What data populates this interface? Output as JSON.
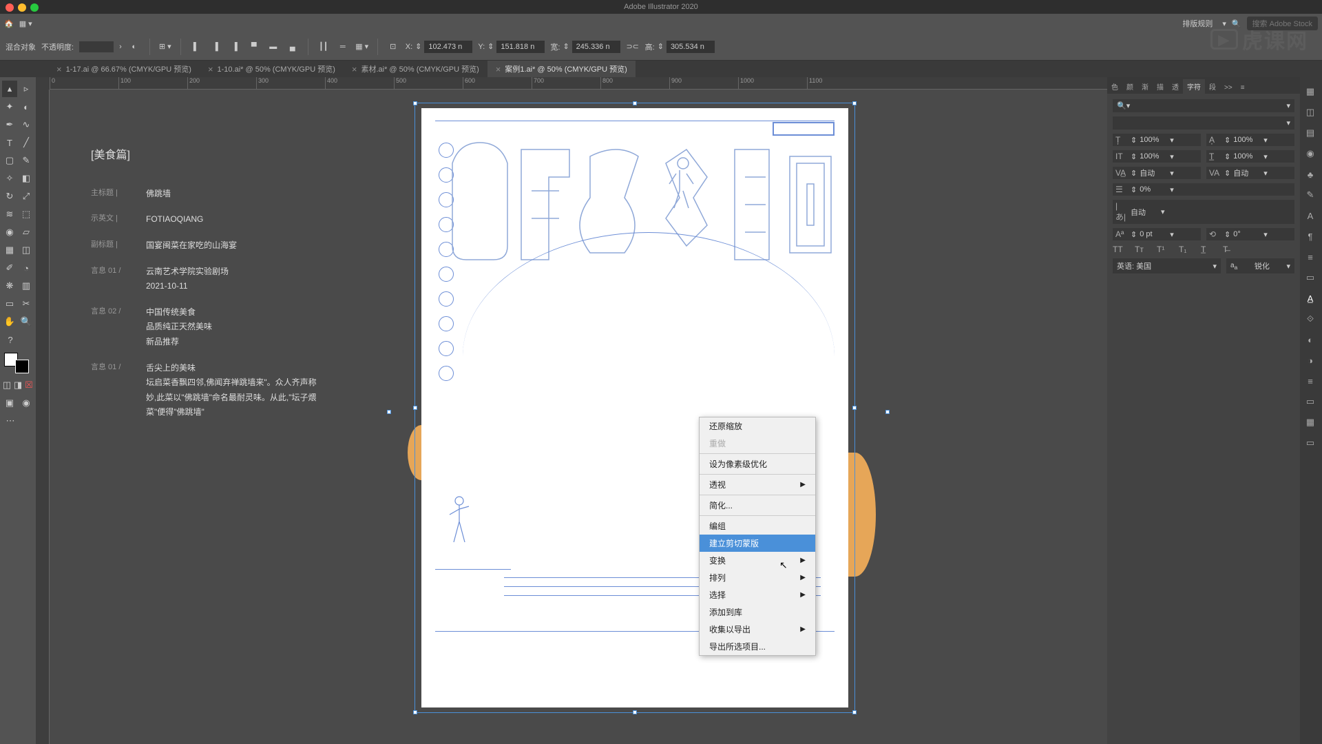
{
  "app_title": "Adobe Illustrator 2020",
  "menubar": {
    "layout_rules": "排版规则",
    "search_placeholder": "搜索 Adobe Stock"
  },
  "control_bar": {
    "object_label": "混合对象",
    "opacity_label": "不透明度:",
    "opacity_value": "",
    "x_label": "X:",
    "x_value": "102.473 n",
    "y_label": "Y:",
    "y_value": "151.818 n",
    "w_label": "宽:",
    "w_value": "245.336 n",
    "h_label": "高:",
    "h_value": "305.534 n"
  },
  "tabs": [
    {
      "label": "1-17.ai @ 66.67% (CMYK/GPU 预览)",
      "active": false
    },
    {
      "label": "1-10.ai* @ 50% (CMYK/GPU 预览)",
      "active": false
    },
    {
      "label": "素材.ai* @ 50% (CMYK/GPU 预览)",
      "active": false
    },
    {
      "label": "案例1.ai* @ 50% (CMYK/GPU 预览)",
      "active": true
    }
  ],
  "ruler_marks": [
    "0",
    "100",
    "200",
    "300",
    "400",
    "500",
    "600",
    "700",
    "800",
    "900",
    "1000",
    "1100"
  ],
  "notes": {
    "title": "[美食篇]",
    "rows": [
      {
        "label": "主标题 |",
        "value": "佛跳墙"
      },
      {
        "label": "示英文 |",
        "value": "FOTIAOQIANG"
      },
      {
        "label": "副标题 |",
        "value": "国宴闽菜在家吃的山海宴"
      },
      {
        "label": "言息 01 /",
        "value": "云南艺术学院实验剧场\n2021-10-11"
      },
      {
        "label": "言息 02 /",
        "value": "中国传统美食\n品质纯正天然美味\n新品推荐"
      },
      {
        "label": "言息 01 /",
        "value": "舌尖上的美味\n坛启菜香飘四邻,佛闻弃禅跳墙来\"。众人齐声称妙,此菜以\"佛跳墙\"命名最耐灵味。从此,\"坛子煨菜\"便得\"佛跳墙\""
      }
    ]
  },
  "context_menu": {
    "items": [
      {
        "label": "还原缩放",
        "type": "item"
      },
      {
        "label": "重做",
        "type": "disabled"
      },
      {
        "type": "sep"
      },
      {
        "label": "设为像素级优化",
        "type": "item"
      },
      {
        "type": "sep"
      },
      {
        "label": "透视",
        "type": "submenu"
      },
      {
        "type": "sep"
      },
      {
        "label": "简化...",
        "type": "item"
      },
      {
        "type": "sep"
      },
      {
        "label": "编组",
        "type": "item"
      },
      {
        "label": "建立剪切蒙版",
        "type": "highlighted"
      },
      {
        "label": "变换",
        "type": "submenu"
      },
      {
        "label": "排列",
        "type": "submenu"
      },
      {
        "label": "选择",
        "type": "submenu"
      },
      {
        "label": "添加到库",
        "type": "item"
      },
      {
        "label": "收集以导出",
        "type": "submenu"
      },
      {
        "label": "导出所选项目...",
        "type": "item"
      }
    ]
  },
  "char_panel": {
    "tabs": [
      "色",
      "颜",
      "渐",
      "描",
      "透",
      "字符",
      "段",
      ">>"
    ],
    "active_tab": "字符",
    "size_value": "100%",
    "leading_value": "100%",
    "tracking_value": "自动",
    "kerning_value": "自动",
    "vscale": "0%",
    "hscale": "自动",
    "baseline": "0 pt",
    "rotation": "0°",
    "language": "英语: 美国",
    "aa": "锐化"
  },
  "watermark_text": "虎课网"
}
